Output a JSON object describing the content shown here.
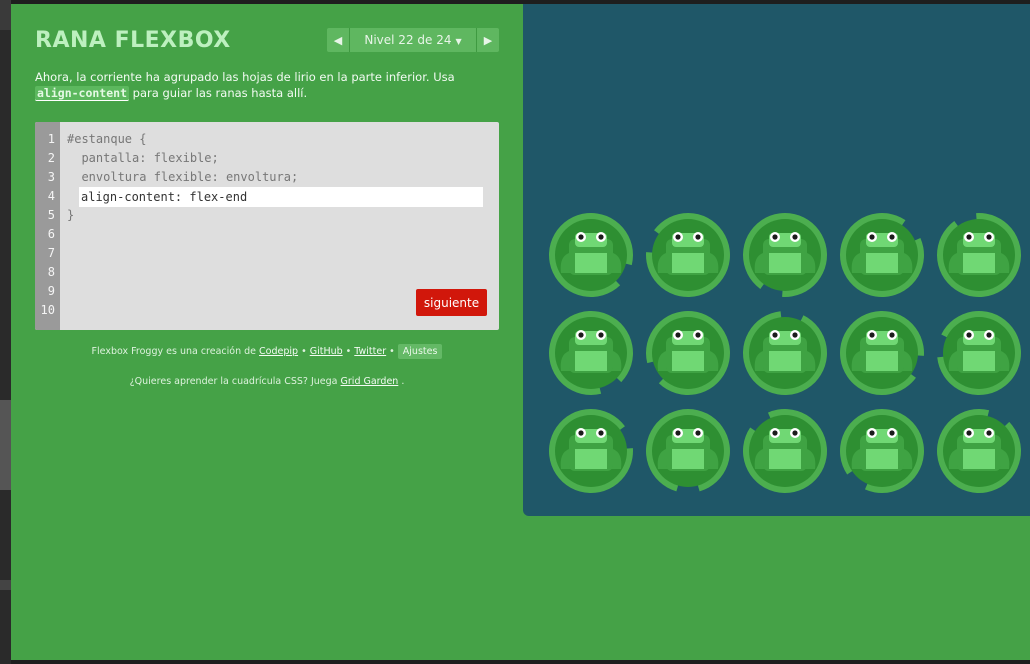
{
  "header": {
    "logo": "RANA FLEXBOX",
    "level_indicator": "Nivel 22 de 24",
    "prev_icon": "triangle-left-icon",
    "next_icon": "triangle-right-icon"
  },
  "instructions": {
    "text_before": "Ahora, la corriente ha agrupado las hojas de lirio en la parte inferior. Usa ",
    "code": "align-content",
    "text_after": " para guiar las ranas hasta allí."
  },
  "editor": {
    "line_numbers": [
      "1",
      "2",
      "3",
      "4",
      "5",
      "6",
      "7",
      "8",
      "9",
      "10"
    ],
    "line1": "#estanque {",
    "line2": "  pantalla: flexible;",
    "line3": "  envoltura flexible: envoltura;",
    "input_value": "align-content: flex-end",
    "line5": "}",
    "next_button": "siguiente"
  },
  "credits": {
    "prefix": "Flexbox Froggy es una creación de ",
    "codepip": "Codepip",
    "github": "GitHub",
    "twitter": "Twitter",
    "settings": "Ajustes"
  },
  "promo": {
    "prefix": "¿Quieres aprender la cuadrícula CSS? Juega ",
    "link": "Grid Garden",
    "suffix": " ."
  },
  "pond": {
    "rows": 3,
    "cols": 5,
    "frog_count": 15,
    "lilypad_icon": "lilypad-icon",
    "frog_icon": "frog-icon"
  },
  "colors": {
    "app_bg": "#45a247",
    "pond_bg": "#1f5768",
    "lilypad": "#2e8f32",
    "lilypad_light": "#4cae4f",
    "frog": "#70d874",
    "frog_dark": "#3fa343",
    "next_button": "#d1170b"
  }
}
